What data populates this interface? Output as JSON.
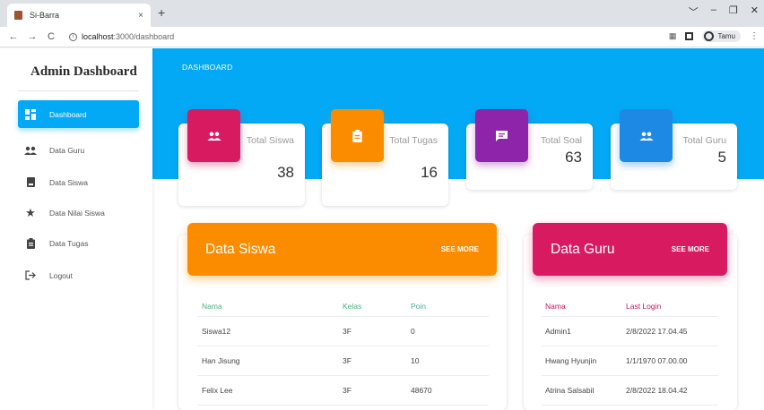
{
  "browser": {
    "tab_title": "Si-Barra",
    "tab_close": "×",
    "new_tab": "+",
    "url_host": "localhost",
    "url_rest": ":3000/dashboard",
    "profile_name": "Tamu",
    "controls": [
      "﹀",
      "–",
      "❐",
      "✕"
    ]
  },
  "sidebar": {
    "brand": "Admin Dashboard",
    "items": [
      {
        "label": "Dashboard",
        "icon": "dashboard-icon",
        "active": true
      },
      {
        "label": "Data Guru",
        "icon": "people-icon",
        "active": false
      },
      {
        "label": "Data Siswa",
        "icon": "person-badge-icon",
        "active": false
      },
      {
        "label": "Data Nilai Siswa",
        "icon": "star-icon",
        "active": false
      },
      {
        "label": "Data Tugas",
        "icon": "clipboard-icon",
        "active": false
      },
      {
        "label": "Logout",
        "icon": "logout-icon",
        "active": false
      }
    ]
  },
  "header": {
    "title": "DASHBOARD"
  },
  "stats": [
    {
      "label": "Total Siswa",
      "value": "38",
      "color": "#d81b60",
      "icon": "people-icon"
    },
    {
      "label": "Total Tugas",
      "value": "16",
      "color": "#fb8c00",
      "icon": "clipboard-icon"
    },
    {
      "label": "Total Soal",
      "value": "63",
      "color": "#8e24aa",
      "icon": "chat-icon"
    },
    {
      "label": "Total Guru",
      "value": "5",
      "color": "#1e88e5",
      "icon": "people-icon"
    }
  ],
  "data_siswa": {
    "title": "Data Siswa",
    "more": "SEE MORE",
    "color": "#fb8c00",
    "columns": [
      "Nama",
      "Kelas",
      "Poin"
    ],
    "rows": [
      [
        "Siswa12",
        "3F",
        "0"
      ],
      [
        "Han Jisung",
        "3F",
        "10"
      ],
      [
        "Felix Lee",
        "3F",
        "48670"
      ]
    ]
  },
  "data_guru": {
    "title": "Data Guru",
    "more": "SEE MORE",
    "color": "#d81b60",
    "columns": [
      "Nama",
      "Last Login"
    ],
    "rows": [
      [
        "Admin1",
        "2/8/2022 17.04.45"
      ],
      [
        "Hwang Hyunjin",
        "1/1/1970 07.00.00"
      ],
      [
        "Atrina Salsabil",
        "2/8/2022 18.04.42"
      ]
    ]
  },
  "colors": {
    "header_bg": "#03a9f4",
    "active_nav": "#03a9f4"
  }
}
